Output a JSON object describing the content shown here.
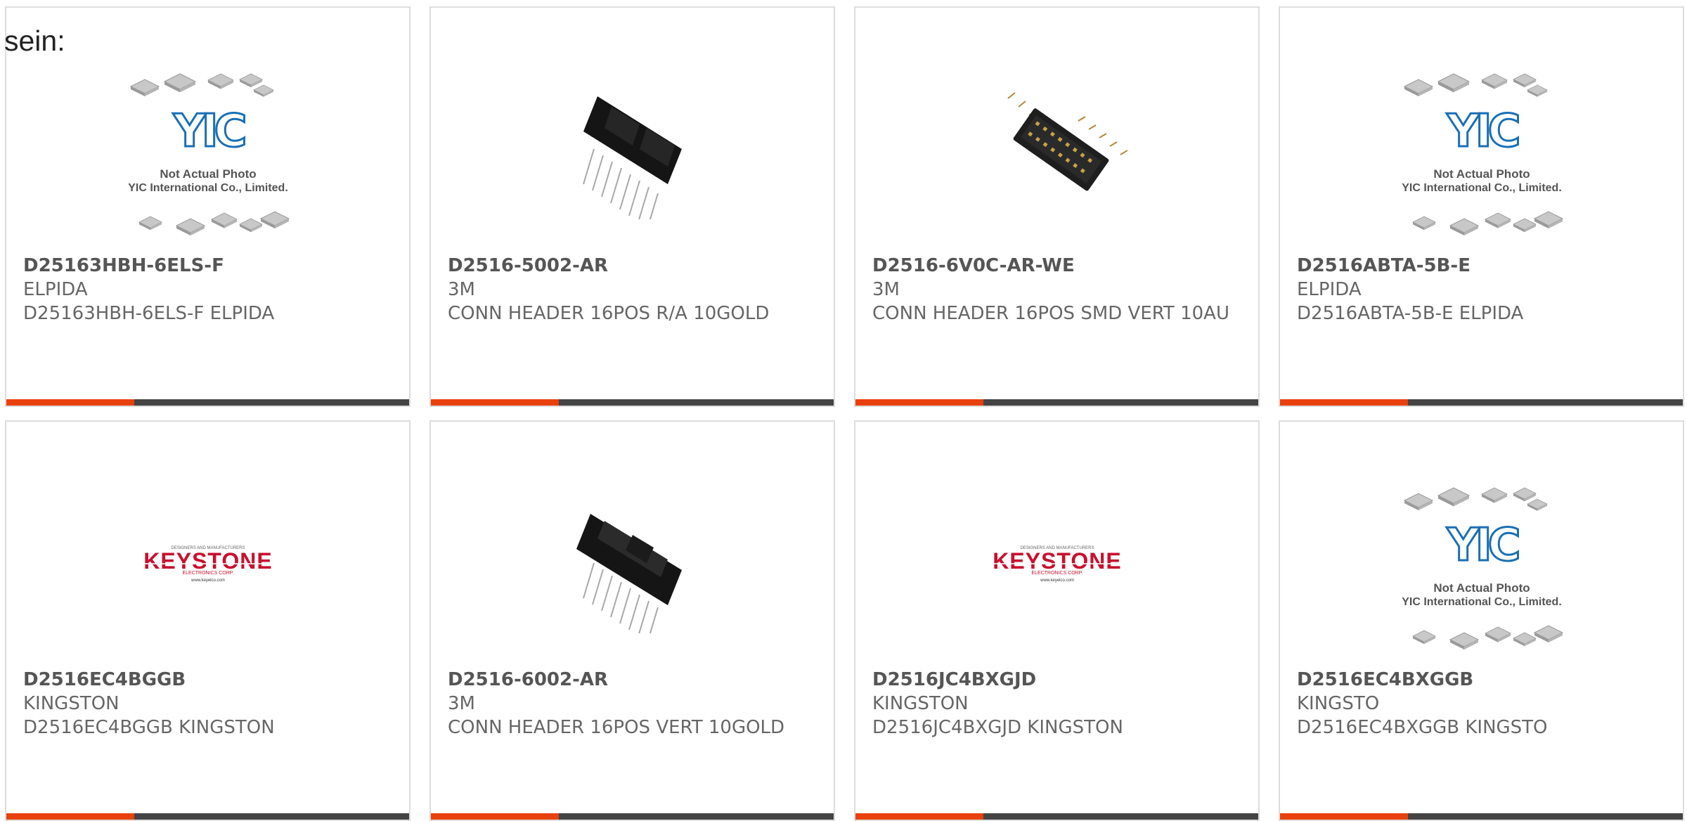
{
  "page": {
    "label": "sein:"
  },
  "colors": {
    "bar_accent": "#e8410e",
    "bar_dark": "#444444",
    "text_gray": "#666666",
    "keystone_red": "#c8102e",
    "yic_blue": "#1a6fb5"
  },
  "placeholder_image": {
    "logo_text": "YIC",
    "line1": "Not Actual Photo",
    "line2": "YIC International Co., Limited."
  },
  "keystone_image": {
    "top_text": "DESIGNERS AND MANUFACTURERS",
    "logo_text": "KEYSTONE",
    "sub_text": "ELECTRONICS CORP.",
    "url_text": "www.keyelco.com"
  },
  "products": [
    {
      "part_number": "D25163HBH-6ELS-F",
      "manufacturer": "ELPIDA",
      "description": "D25163HBH-6ELS-F ELPIDA",
      "image": "placeholder-photo"
    },
    {
      "part_number": "D2516-5002-AR",
      "manufacturer": "3M",
      "description": "CONN HEADER 16POS R/A 10GOLD",
      "image": "right-angle-header-photo"
    },
    {
      "part_number": "D2516-6V0C-AR-WE",
      "manufacturer": "3M",
      "description": "CONN HEADER 16POS SMD VERT 10AU",
      "image": "smd-header-photo"
    },
    {
      "part_number": "D2516ABTA-5B-E",
      "manufacturer": "ELPIDA",
      "description": "D2516ABTA-5B-E ELPIDA",
      "image": "placeholder-photo"
    },
    {
      "part_number": "D2516EC4BGGB",
      "manufacturer": "KINGSTON",
      "description": "D2516EC4BGGB KINGSTON",
      "image": "keystone-logo"
    },
    {
      "part_number": "D2516-6002-AR",
      "manufacturer": "3M",
      "description": "CONN HEADER 16POS VERT 10GOLD",
      "image": "vertical-header-photo"
    },
    {
      "part_number": "D2516JC4BXGJD",
      "manufacturer": "KINGSTON",
      "description": "D2516JC4BXGJD KINGSTON",
      "image": "keystone-logo"
    },
    {
      "part_number": "D2516EC4BXGGB",
      "manufacturer": "KINGSTO",
      "description": "D2516EC4BXGGB KINGSTO",
      "image": "placeholder-photo"
    }
  ]
}
